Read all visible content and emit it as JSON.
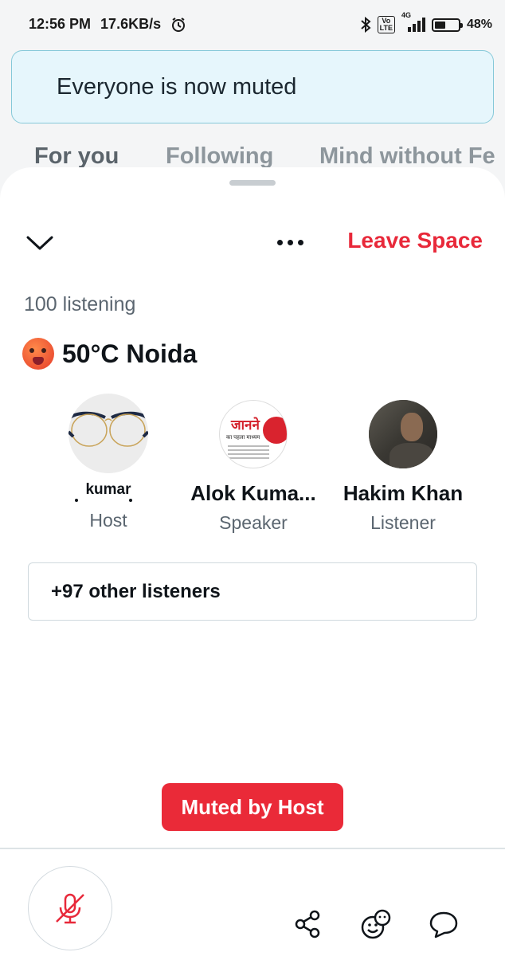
{
  "status_bar": {
    "time": "12:56 PM",
    "speed": "17.6KB/s",
    "alarm_icon": "alarm-icon",
    "bluetooth_icon": "bluetooth-icon",
    "volte": "Vo LTE",
    "network": "4G",
    "battery": "48%",
    "battery_level": 0.48
  },
  "toast": {
    "message": "Everyone is now muted"
  },
  "background_tabs": [
    "For you",
    "Following",
    "Mind without Fe"
  ],
  "space": {
    "leave_label": "Leave Space",
    "listening": "100 listening",
    "title": "50°C Noida",
    "title_emoji": "hot-face-emoji"
  },
  "participants": [
    {
      "name": "kumar",
      "role": "Host"
    },
    {
      "name": "Alok Kuma...",
      "role": "Speaker"
    },
    {
      "name": "Hakim Khan",
      "role": "Listener"
    }
  ],
  "avatar2_text": {
    "line1": "जानने",
    "line2": "का पहला माध्यम"
  },
  "others_label": "+97 other listeners",
  "muted_label": "Muted by Host",
  "colors": {
    "accent_red": "#e8293a",
    "muted_bg": "#ea2a38",
    "toast_bg": "#e6f6fc",
    "toast_border": "#86c9d9"
  }
}
